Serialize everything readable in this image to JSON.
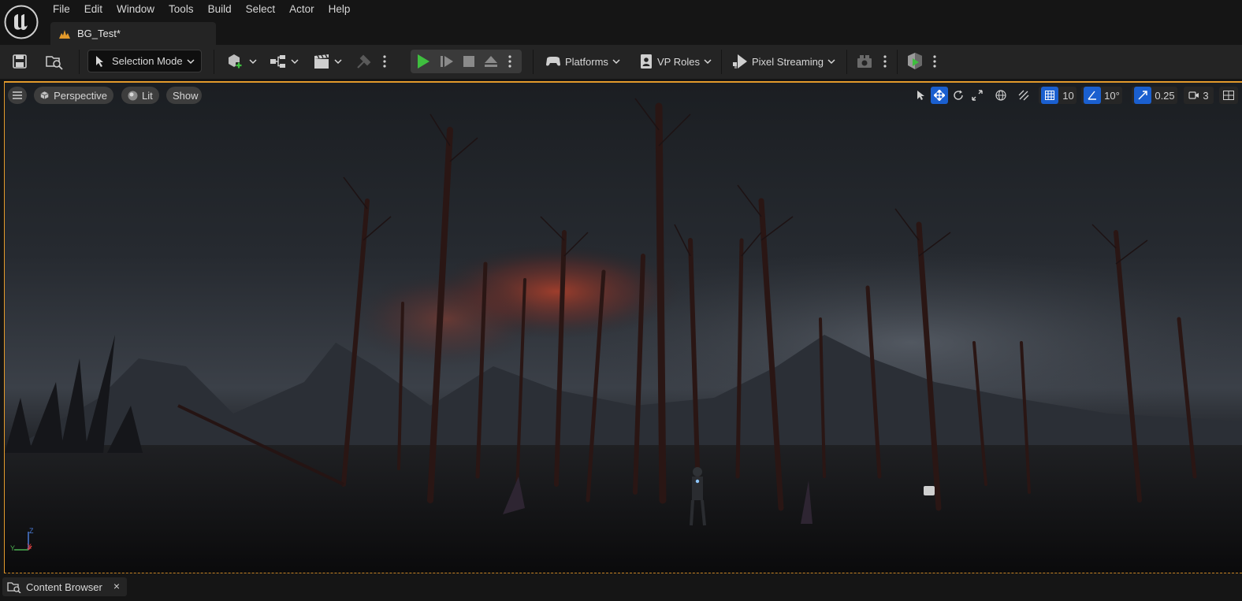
{
  "app": {
    "menu": [
      "File",
      "Edit",
      "Window",
      "Tools",
      "Build",
      "Select",
      "Actor",
      "Help"
    ],
    "document_tab": "BG_Test*"
  },
  "toolbar": {
    "selection_mode": "Selection Mode",
    "platforms": "Platforms",
    "vp_roles": "VP Roles",
    "pixel_streaming": "Pixel Streaming"
  },
  "viewport": {
    "view_mode": "Perspective",
    "lighting": "Lit",
    "show": "Show",
    "grid_snap": "10",
    "rotation_snap": "10°",
    "scale_snap": "0.25",
    "camera_speed": "3",
    "axis": {
      "x": "X",
      "y": "Y",
      "z": "Z"
    }
  },
  "bottom": {
    "content_browser": "Content Browser",
    "close": "×"
  },
  "colors": {
    "accent_orange": "#e39a2b",
    "play_green": "#3fbf3f",
    "active_blue": "#1a5fcf"
  },
  "icons": [
    "unreal-logo-icon",
    "blueprint-icon",
    "save-icon",
    "browse-icon",
    "add-actor-icon",
    "blueprint-graph-icon",
    "cinematics-icon",
    "modeling-icon",
    "play-icon",
    "advance-frame-icon",
    "stop-icon",
    "eject-icon",
    "platforms-icon",
    "vp-roles-icon",
    "pixel-streaming-icon",
    "camera-icon",
    "build-icon"
  ]
}
